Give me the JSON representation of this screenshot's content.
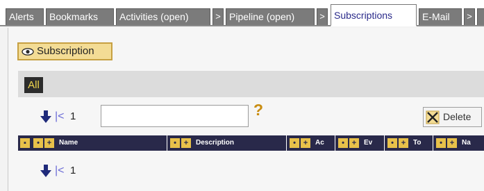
{
  "tabs": [
    {
      "label": "Alerts"
    },
    {
      "label": "Bookmarks"
    },
    {
      "label": "Activities (open)"
    },
    {
      "label": "Pipeline (open)"
    },
    {
      "label": "Subscriptions"
    },
    {
      "label": "E-Mail"
    }
  ],
  "tab_separator": ">",
  "toolbar": {
    "subscription_label": "Subscription",
    "all_label": "All",
    "delete_label": "Delete",
    "help_glyph": "?"
  },
  "pager": {
    "first_glyph": "|<",
    "page_number": "1"
  },
  "search": {
    "value": ""
  },
  "columns": [
    {
      "label": "Name"
    },
    {
      "label": "Description"
    },
    {
      "label": "Ac"
    },
    {
      "label": "Ev"
    },
    {
      "label": "To"
    },
    {
      "label": "Na"
    }
  ],
  "colors": {
    "accent_yellow": "#f3dc95",
    "header_navy": "#29294a",
    "tab_gray": "#7b7b7b"
  }
}
